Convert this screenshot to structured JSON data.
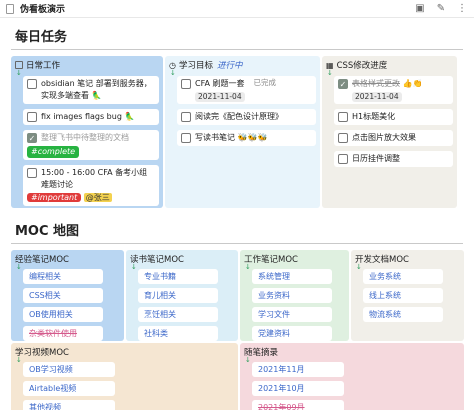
{
  "window": {
    "title": "伪看板演示"
  },
  "daily": {
    "heading": "每日任务",
    "col1": {
      "title": "日常工作",
      "tasks": [
        {
          "text": "obsidian 笔记 部署到服务器，实现多端查看",
          "emoji": "🦜"
        },
        {
          "text": "fix images flags bug",
          "emoji": "🦜"
        },
        {
          "text": "整理飞书中待整理的文档",
          "tag": "#complete"
        },
        {
          "text": "15:00 - 16:00 CFA 备考小组难题讨论",
          "tag": "#important",
          "mention": "@张三"
        }
      ]
    },
    "col2": {
      "title": "学习目标",
      "status": "进行中",
      "items": [
        {
          "text": "CFA 刷题一套",
          "badge": "已完成",
          "date": "2021-11-04"
        },
        {
          "text": "阅读完《配色设计原理》"
        },
        {
          "text": "写读书笔记",
          "emoji": "🐝🐝🐝"
        }
      ]
    },
    "col3": {
      "title": "CSS修改进度",
      "items": [
        {
          "text": "表格样式更改",
          "emoji": "👍👏",
          "date": "2021-11-04"
        },
        {
          "text": "H1标题美化"
        },
        {
          "text": "点击图片放大效果"
        },
        {
          "text": "日历挂件调整"
        }
      ]
    }
  },
  "moc": {
    "heading": "MOC 地图",
    "boxes": [
      {
        "title": "经验笔记MOC",
        "items": [
          "编程相关",
          "CSS相关",
          "OB使用相关",
          "杂类软件使用"
        ]
      },
      {
        "title": "读书笔记MOC",
        "items": [
          "专业书籍",
          "育儿相关",
          "烹饪相关",
          "社科类"
        ]
      },
      {
        "title": "工作笔记MOC",
        "items": [
          "系统管理",
          "业务资料",
          "学习文件",
          "党建资料"
        ]
      },
      {
        "title": "开发文档MOC",
        "items": [
          "业务系统",
          "线上系统",
          "物流系统"
        ]
      },
      {
        "title": "学习视频MOC",
        "items": [
          "OB学习视频",
          "Airtable视频",
          "其他视频"
        ]
      },
      {
        "title": "随笔摘录",
        "items": [
          "2021年11月",
          "2021年10月",
          "2021年09月"
        ]
      }
    ]
  },
  "colors": {
    "blue": "#b9d6f2",
    "green_tag": "#27b341",
    "red_tag": "#e03b3b",
    "accent": "#3b67c9"
  }
}
